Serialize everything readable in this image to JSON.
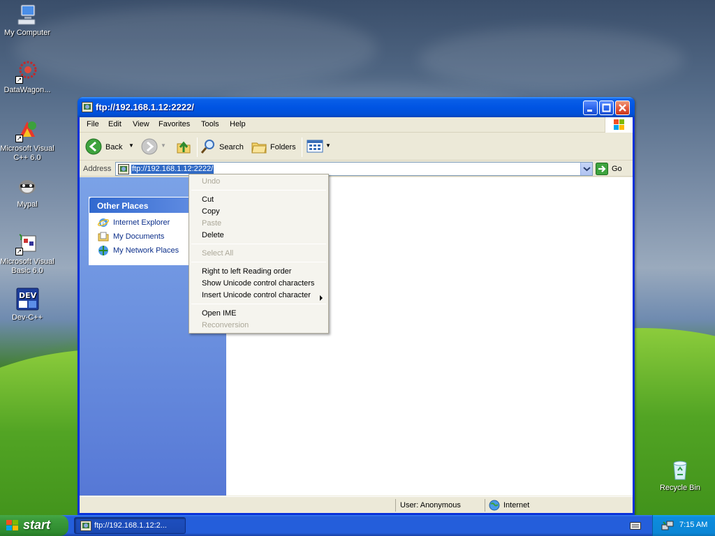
{
  "desktop": {
    "icons": [
      {
        "label": "My Computer",
        "icon": "computer-icon"
      },
      {
        "label": "DataWagon...",
        "icon": "datawagon-icon"
      },
      {
        "label": "Microsoft Visual C++ 6.0",
        "icon": "visual-cpp-icon"
      },
      {
        "label": "Mypal",
        "icon": "mypal-icon"
      },
      {
        "label": "Microsoft Visual Basic 6.0",
        "icon": "visual-basic-icon"
      },
      {
        "label": "Dev-C++",
        "icon": "dev-cpp-icon"
      },
      {
        "label": "Recycle Bin",
        "icon": "recycle-bin-icon"
      }
    ]
  },
  "window": {
    "title": "ftp://192.168.1.12:2222/",
    "menu": [
      "File",
      "Edit",
      "View",
      "Favorites",
      "Tools",
      "Help"
    ],
    "toolbar": {
      "back": "Back",
      "search": "Search",
      "folders": "Folders"
    },
    "address": {
      "label": "Address",
      "value": "ftp://192.168.1.12:2222/",
      "go": "Go"
    },
    "other_places": {
      "title": "Other Places",
      "items": [
        "Internet Explorer",
        "My Documents",
        "My Network Places"
      ]
    },
    "status": {
      "user": "User: Anonymous",
      "zone": "Internet"
    }
  },
  "context_menu": {
    "items": [
      {
        "label": "Undo",
        "enabled": false
      },
      {
        "label": "Cut",
        "enabled": true
      },
      {
        "label": "Copy",
        "enabled": true
      },
      {
        "label": "Paste",
        "enabled": false
      },
      {
        "label": "Delete",
        "enabled": true
      },
      {
        "label": "Select All",
        "enabled": false
      },
      {
        "label": "Right to left Reading order",
        "enabled": true
      },
      {
        "label": "Show Unicode control characters",
        "enabled": true
      },
      {
        "label": "Insert Unicode control character",
        "enabled": true
      },
      {
        "label": "Open IME",
        "enabled": true
      },
      {
        "label": "Reconversion",
        "enabled": false
      }
    ]
  },
  "taskbar": {
    "start": "start",
    "task_label": "ftp://192.168.1.12:2...",
    "clock": "7:15 AM"
  },
  "colors": {
    "titlebar": "#0054e3",
    "selection": "#316ac5",
    "start_green": "#3c9c3c",
    "taskbar_blue": "#245edb"
  }
}
